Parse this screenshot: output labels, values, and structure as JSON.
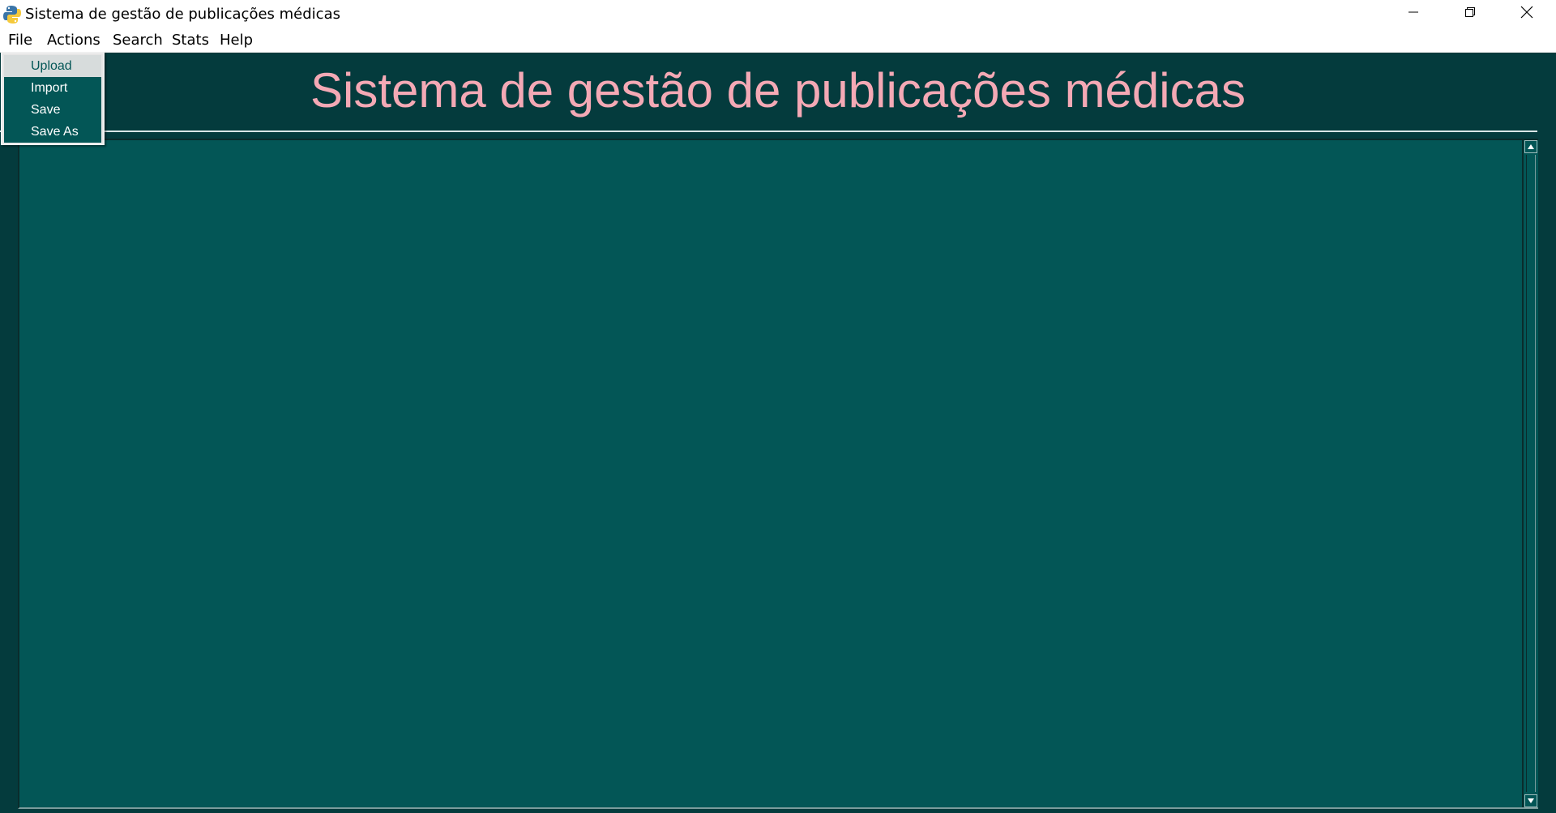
{
  "window": {
    "title": "Sistema de gestão de publicações médicas"
  },
  "menubar": {
    "items": [
      {
        "label": "File"
      },
      {
        "label": "Actions"
      },
      {
        "label": "Search"
      },
      {
        "label": "Stats"
      },
      {
        "label": "Help"
      }
    ]
  },
  "file_menu": {
    "items": [
      {
        "label": "Upload",
        "highlighted": true
      },
      {
        "label": "Import"
      },
      {
        "label": "Save"
      },
      {
        "label": "Save As"
      }
    ]
  },
  "header": {
    "title": "Sistema de gestão de publicações médicas"
  },
  "colors": {
    "app_background": "#043b3d",
    "content_background": "#035656",
    "title_color": "#f4a9b5",
    "menu_highlight": "#d7dcdc"
  },
  "icons": {
    "app": "python-icon",
    "minimize": "minimize-icon",
    "maximize": "restore-icon",
    "close": "close-icon",
    "scroll_up": "arrow-up-icon",
    "scroll_down": "arrow-down-icon"
  }
}
